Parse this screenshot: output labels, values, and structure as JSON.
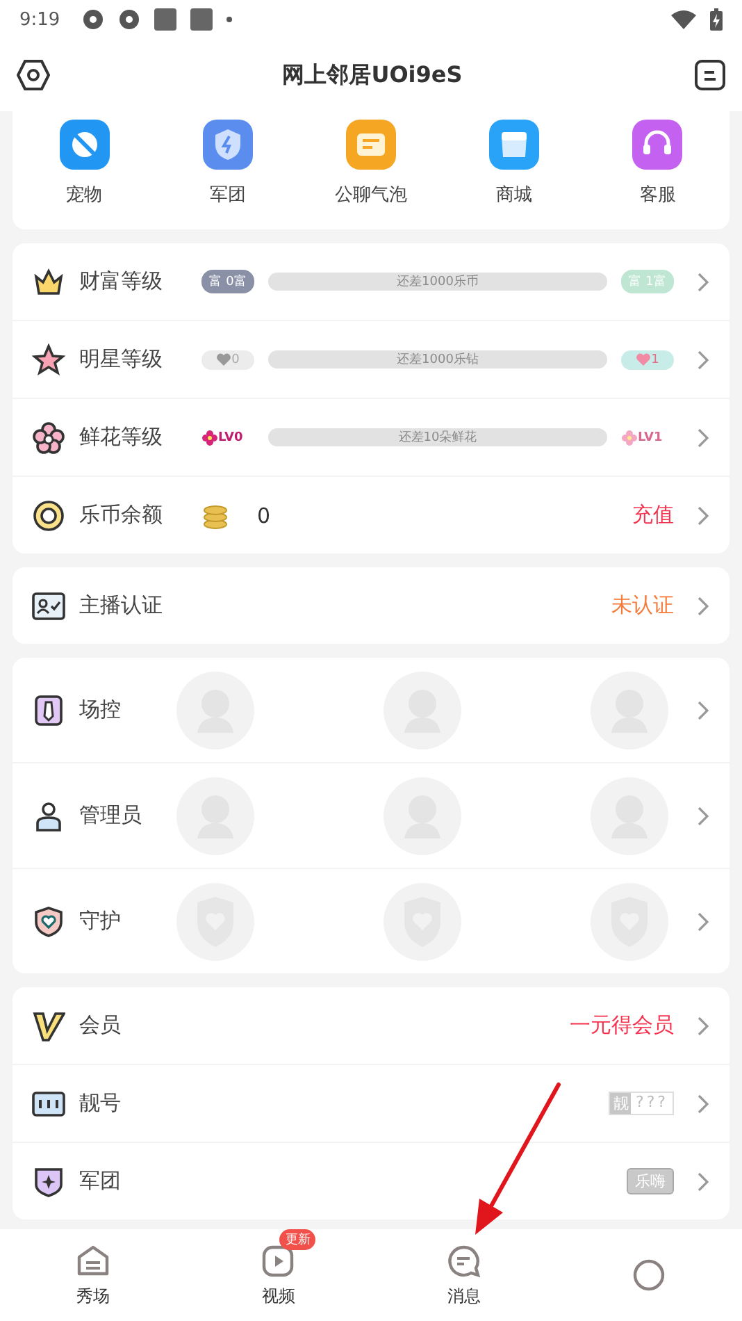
{
  "status_bar": {
    "time": "9:19"
  },
  "header": {
    "title": "网上邻居UOi9eS"
  },
  "shortcuts": [
    {
      "label": "宠物"
    },
    {
      "label": "军团"
    },
    {
      "label": "公聊气泡"
    },
    {
      "label": "商城"
    },
    {
      "label": "客服"
    }
  ],
  "levels": [
    {
      "label": "财富等级",
      "kind": "wealth",
      "start_icon": "富",
      "start_badge": "0富",
      "bar_text": "还差1000乐币",
      "level": 0,
      "end_icon": "富",
      "end_badge": "1富"
    },
    {
      "label": "明星等级",
      "kind": "star",
      "start_badge": "0",
      "bar_text": "还差1000乐钻",
      "level": 0,
      "end_badge": "1"
    },
    {
      "label": "鲜花等级",
      "kind": "flower",
      "start_badge": "LV0",
      "bar_text": "还差10朵鲜花",
      "level": 0,
      "end_badge": "LV1"
    }
  ],
  "balance": {
    "label": "乐币余额",
    "amount": "0",
    "action": "充值"
  },
  "certification": {
    "label": "主播认证",
    "status": "未认证"
  },
  "roles": [
    {
      "label": "场控",
      "kind": "tie",
      "avatars": [
        {
          "kind": "person"
        },
        {
          "kind": "person"
        },
        {
          "kind": "person"
        }
      ]
    },
    {
      "label": "管理员",
      "kind": "admin",
      "avatars": [
        {
          "kind": "person"
        },
        {
          "kind": "person"
        },
        {
          "kind": "person"
        }
      ]
    },
    {
      "label": "守护",
      "kind": "guard",
      "avatars": [
        {
          "kind": "shield"
        },
        {
          "kind": "shield"
        },
        {
          "kind": "shield"
        }
      ]
    }
  ],
  "extras": [
    {
      "label": "会员",
      "kind": "vip",
      "value": "一元得会员"
    },
    {
      "label": "靓号",
      "kind": "number",
      "tag": "靓",
      "tag_value": "???"
    },
    {
      "label": "军团",
      "kind": "legion",
      "tag": "乐嗨"
    }
  ],
  "tabs": [
    {
      "label": "秀场",
      "kind": "home",
      "selected": false
    },
    {
      "label": "视频",
      "kind": "video",
      "badge": "更新",
      "selected": false
    },
    {
      "label": "消息",
      "kind": "chat",
      "selected": false
    },
    {
      "kind": "profile",
      "selected": false
    }
  ]
}
